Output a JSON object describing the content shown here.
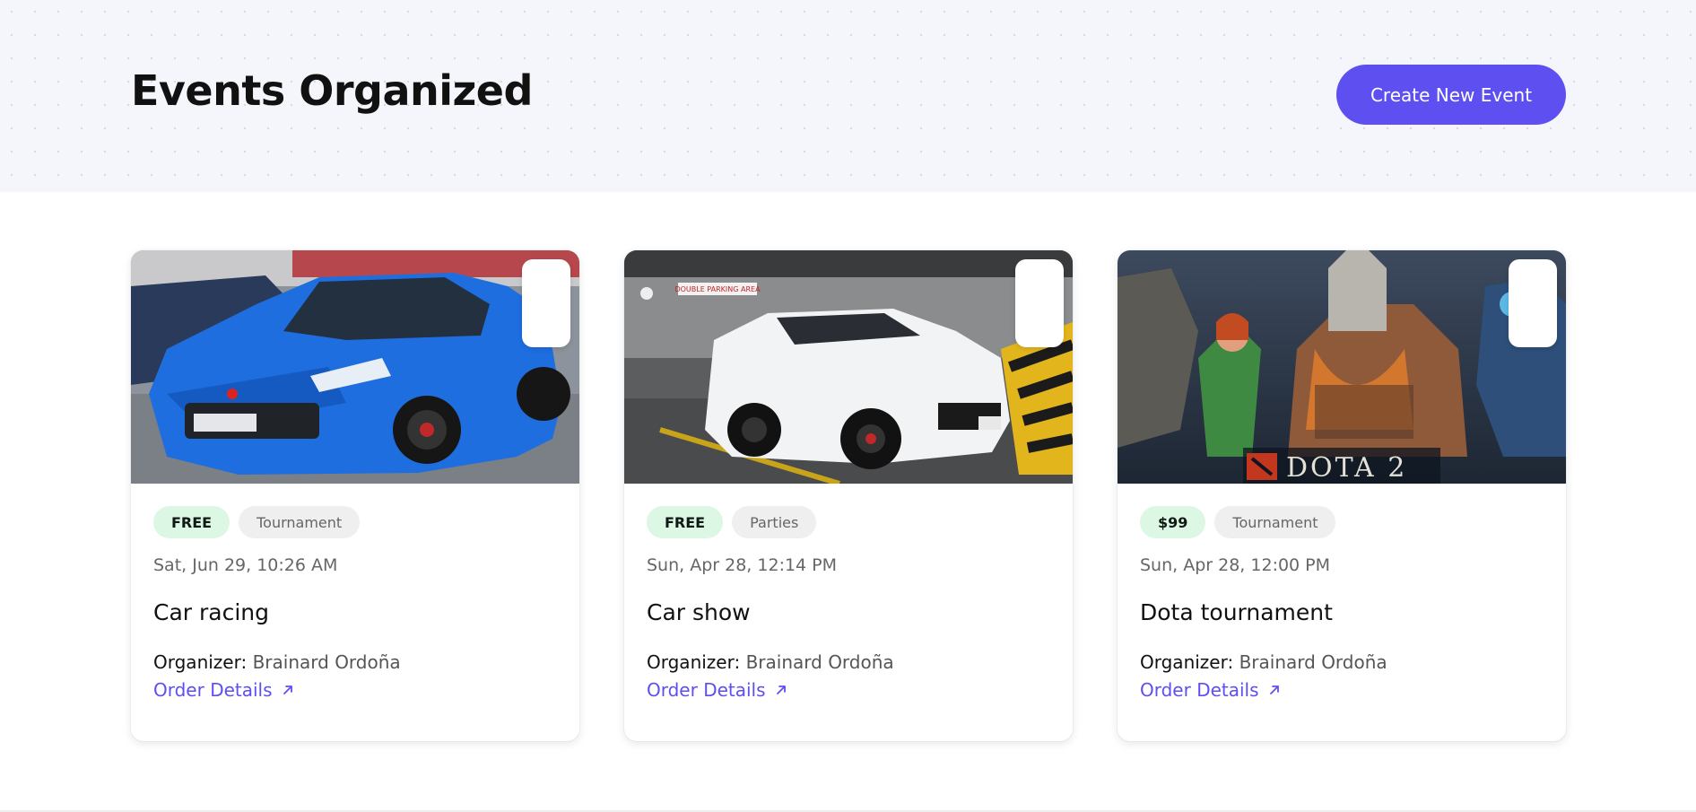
{
  "header": {
    "title": "Events Organized",
    "create_button": "Create New Event"
  },
  "colors": {
    "accent": "#5e4ff0",
    "delete": "#e53935",
    "price_tag_bg": "#dcf7e3",
    "category_tag_bg": "#efefef"
  },
  "events": [
    {
      "image": "blue-honda-civic-type-r-photo",
      "price": "FREE",
      "category": "Tournament",
      "date": "Sat, Jun 29, 10:26 AM",
      "title": "Car racing",
      "organizer_label": "Organizer:",
      "organizer": "Brainard Ordoña",
      "order_link": "Order Details",
      "icons": {
        "edit": "edit-icon",
        "delete": "trash-icon",
        "link": "arrow-up-right-icon"
      }
    },
    {
      "image": "white-honda-civic-type-r-photo",
      "image_sign": "DOUBLE PARKING AREA",
      "price": "FREE",
      "category": "Parties",
      "date": "Sun, Apr 28, 12:14 PM",
      "title": "Car show",
      "organizer_label": "Organizer:",
      "organizer": "Brainard Ordoña",
      "order_link": "Order Details",
      "icons": {
        "edit": "edit-icon",
        "delete": "trash-icon",
        "link": "arrow-up-right-icon"
      }
    },
    {
      "image": "dota-2-heroes-artwork",
      "image_caption": "DOTA 2",
      "price": "$99",
      "category": "Tournament",
      "date": "Sun, Apr 28, 12:00 PM",
      "title": "Dota tournament",
      "organizer_label": "Organizer:",
      "organizer": "Brainard Ordoña",
      "order_link": "Order Details",
      "icons": {
        "edit": "edit-icon",
        "delete": "trash-icon",
        "link": "arrow-up-right-icon"
      }
    }
  ]
}
